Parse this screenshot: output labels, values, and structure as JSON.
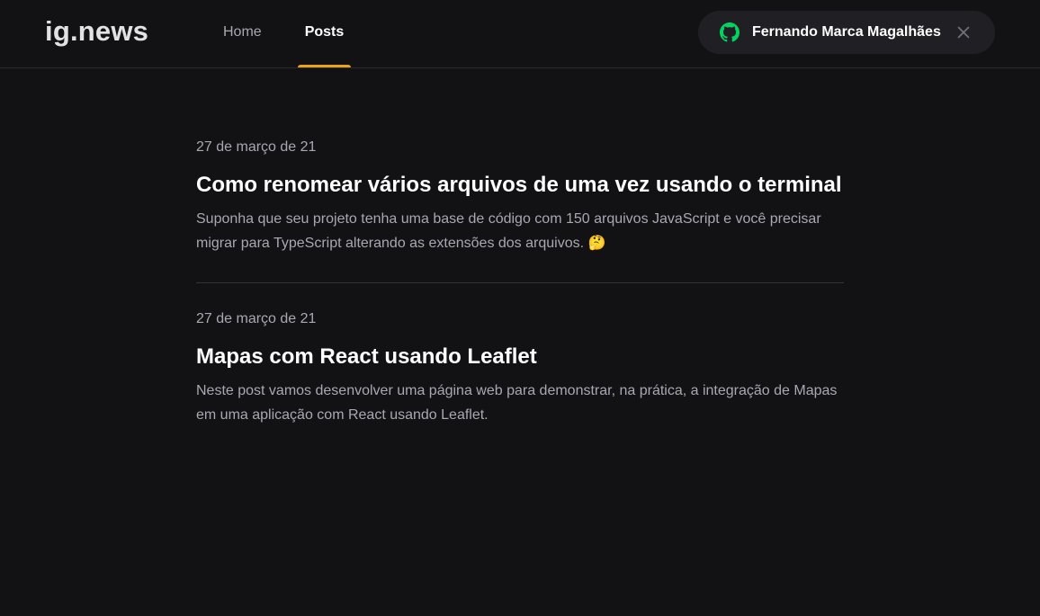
{
  "header": {
    "logo": "ig.news",
    "nav": {
      "home_label": "Home",
      "posts_label": "Posts",
      "active": "Posts"
    },
    "user": {
      "icon": "github-icon",
      "name": "Fernando Marca Magalhães",
      "close_icon": "close-icon"
    }
  },
  "posts": [
    {
      "date": "27 de março de 21",
      "title": "Como renomear vários arquivos de uma vez usando o terminal",
      "excerpt": "Suponha que seu projeto tenha uma base de código com 150 arquivos JavaScript e você precisar migrar para TypeScript alterando as extensões dos arquivos. 🤔"
    },
    {
      "date": "27 de março de 21",
      "title": "Mapas com React usando Leaflet",
      "excerpt": "Neste post vamos desenvolver uma página web para demonstrar, na prática, a integração de Mapas em uma aplicação com React usando Leaflet."
    }
  ],
  "colors": {
    "background": "#121214",
    "accent": "#eba417",
    "github_green": "#04d361",
    "text_muted": "#a8a8b3"
  }
}
